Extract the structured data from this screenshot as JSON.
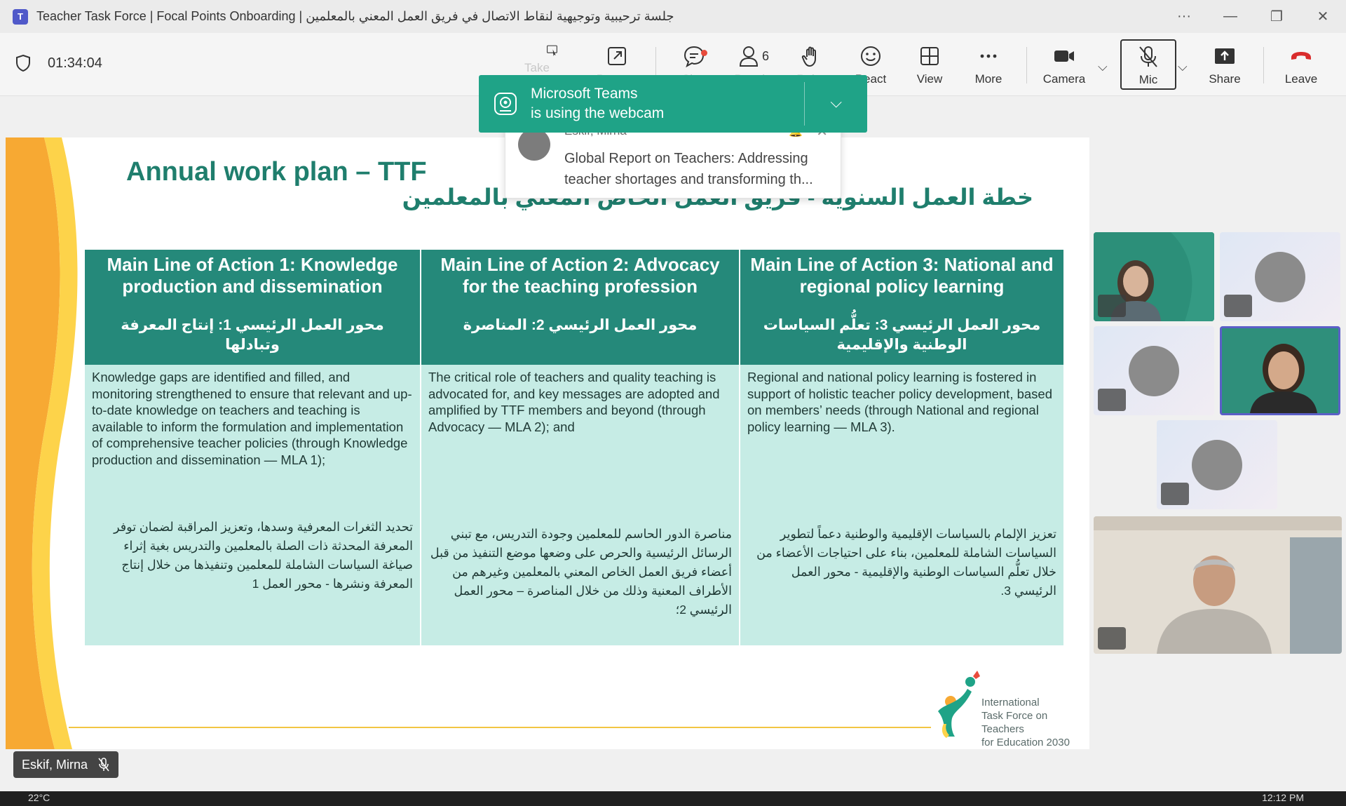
{
  "window": {
    "title": "Teacher Task Force | Focal Points Onboarding | جلسة ترحيبية وتوجيهية لنقاط الاتصال في فريق العمل المعني بالمعلمين"
  },
  "toolbar": {
    "timer": "01:34:04",
    "take_control": "Take control",
    "pop_out": "Pop out",
    "chat": "Chat",
    "people": "People",
    "people_count": "6",
    "raise": "Raise",
    "react": "React",
    "view": "View",
    "more": "More",
    "camera": "Camera",
    "mic": "Mic",
    "share": "Share",
    "leave": "Leave"
  },
  "webcam_toast": {
    "line1": "Microsoft Teams",
    "line2": "is using the webcam"
  },
  "notification": {
    "sender": "Eskif, Mirna",
    "body": "Global Report on Teachers: Addressing teacher shortages and transforming th..."
  },
  "slide": {
    "title": "Annual work plan – TTF",
    "title_ar": "خطة العمل السنوية - فريق العمل الخاص المعني بالمعلمين",
    "columns": [
      {
        "head_en": "Main Line of Action 1: Knowledge production and dissemination",
        "head_ar": "محور العمل الرئيسي 1: إنتاج المعرفة وتبادلها",
        "body_en": "Knowledge gaps are identified and filled, and monitoring strengthened to ensure that relevant and up-to-date knowledge on teachers and teaching is available to inform the formulation and implementation of comprehensive teacher policies (through Knowledge production and dissemination — MLA 1);",
        "body_ar": "تحديد الثغرات المعرفية وسدها، وتعزيز المراقبة لضمان توفر المعرفة المحدثة ذات الصلة بالمعلمين والتدريس بغية إثراء صياغة السياسات الشاملة للمعلمين وتنفيذها من خلال إنتاج المعرفة ونشرها - محور العمل 1"
      },
      {
        "head_en": "Main Line of Action 2: Advocacy for the teaching profession",
        "head_ar": "محور العمل الرئيسي 2: المناصرة",
        "body_en": "The critical role of teachers and quality teaching is advocated for, and key messages are adopted and amplified by TTF members and beyond (through Advocacy — MLA 2); and",
        "body_ar": "مناصرة الدور الحاسم للمعلمين وجودة التدريس، مع تبني الرسائل الرئيسية والحرص على وضعها موضع التنفيذ من قبل أعضاء فريق العمل الخاص المعني بالمعلمين وغيرهم من الأطراف المعنية وذلك من خلال المناصرة – محور العمل الرئيسي 2؛"
      },
      {
        "head_en": "Main Line of Action 3: National and regional policy learning",
        "head_ar": "محور العمل الرئيسي 3: تعلُّم السياسات الوطنية والإقليمية",
        "body_en": "Regional and national policy learning is fostered in support of holistic teacher policy development, based on members’ needs (through National and regional policy learning — MLA 3).",
        "body_ar": "تعزيز الإلمام بالسياسات الإقليمية والوطنية دعماً لتطوير السياسات الشاملة للمعلمين، بناء على احتياجات الأعضاء من خلال تعلُّم السياسات الوطنية والإقليمية - محور العمل الرئيسي 3."
      }
    ],
    "logo_line1": "International",
    "logo_line2": "Task Force on Teachers",
    "logo_line3": "for Education 2030"
  },
  "presenter": {
    "name": "Eskif, Mirna"
  },
  "taskbar": {
    "weather": "22°C",
    "clock": "12:12 PM"
  },
  "colors": {
    "teal_header": "#25897a",
    "teal_body": "#c6ece5",
    "toast": "#1fa387"
  }
}
